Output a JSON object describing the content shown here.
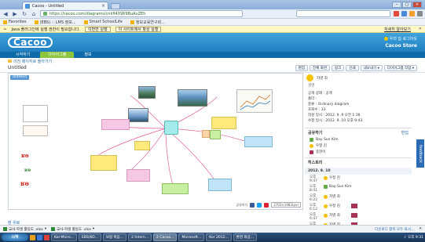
{
  "browser": {
    "tab_title": "Cacoo - Untitled",
    "url": "https://cacoo.com/diagrams/cnkfi4XWi9BuAuZEh",
    "bookmarks": [
      {
        "label": "Favorites"
      },
      {
        "label": "(EBS) :: LMS 정보..."
      },
      {
        "label": "Smart SchoolLife"
      },
      {
        "label": "정보교육연구회..."
      }
    ],
    "java_bar": {
      "message": "Java 플러그인에 실행 권한이 필요합니다.",
      "btn_once": "이번만 실행",
      "btn_always": "이 사이트에서 항상 실행",
      "more_link": "자세히 알아보기",
      "close": "✕"
    }
  },
  "header": {
    "logo": "Cacoo",
    "user_link": "우리 집 로그아웃",
    "store": "Cacoo Store"
  },
  "nav": {
    "tabs": [
      {
        "label": "시작하기"
      },
      {
        "label": "다이어그램"
      },
      {
        "label": "정보"
      }
    ]
  },
  "crumb": "이전 페이지로 돌아가기",
  "diagram": {
    "title": "Untitled",
    "actions": [
      {
        "label": "편집"
      },
      {
        "label": "전체 화면"
      },
      {
        "label": "링크"
      },
      {
        "label": "인쇄"
      },
      {
        "label": "내보내기"
      },
      {
        "label": "다이어그램 작업"
      }
    ],
    "sheet_tab": "Untitled",
    "footer_label": "공유하기",
    "dimensions": "2703×1983(px)"
  },
  "panel": {
    "author": "자영 최",
    "desc_label": "설명",
    "meta": [
      "공개 상태 : 공개",
      "폴더 :",
      "종류 : Ordinary diagram",
      "조회수 : 33",
      "작성 일시 : 2012. 9. 9 오전 1:36",
      "수정 일시 : 2012. 9. 10 오후 9:43"
    ],
    "collab_title": "공유하기",
    "collab_edit": "편집",
    "collaborators": [
      {
        "name": "Bay Sun Kim"
      },
      {
        "name": "우정 김"
      },
      {
        "name": "종현이"
      }
    ],
    "history_title": "히스토리",
    "history_date": "2012. 9. 10",
    "history": [
      {
        "time": "오후 9:47",
        "name": "우정 김"
      },
      {
        "time": "오후 8:41",
        "name": "Bay Sun Kim"
      },
      {
        "time": "오후 6:22",
        "name": "자영 최"
      },
      {
        "time": "오후 6:12",
        "name": "우정 김"
      },
      {
        "time": "오후 6:47",
        "name": "자영 최"
      },
      {
        "time": "오후 6:37",
        "name": "자영 최"
      }
    ],
    "history_date2": "2012. 9. 9",
    "feedback": "feedback"
  },
  "page_footer": "맨 위로",
  "downloads": {
    "items": [
      {
        "label": "교사-학생 활동도 .xlsx"
      },
      {
        "label": "교사-학생 활동도 .xlsx"
      }
    ],
    "show_all": "다운로드 항목 모두 표시..."
  },
  "taskbar": {
    "start": "시작",
    "tasks": [
      {
        "label": "Kor-Micro..."
      },
      {
        "label": "EBS(KO..."
      },
      {
        "label": "보람 복음..."
      },
      {
        "label": "2 Intern..."
      },
      {
        "label": "2 Cacoo..."
      },
      {
        "label": "Microsoft..."
      },
      {
        "label": "Kor 2012..."
      },
      {
        "label": "환경 화상..."
      }
    ],
    "clock": "오후 9:31"
  },
  "colors": {
    "header": "#2a8bd0",
    "active_tab": "#8cc63f",
    "accent": "#2a6cb0"
  }
}
